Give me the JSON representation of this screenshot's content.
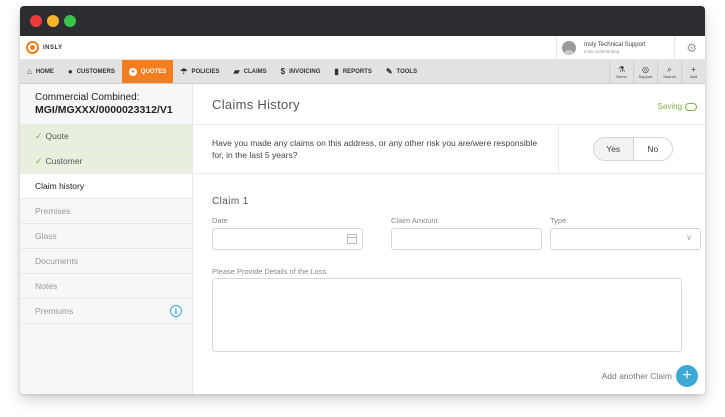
{
  "colors": {
    "titlebar": "#2b2d30",
    "close": "#ed3b3b",
    "minimize": "#f7b32b",
    "maximize": "#3bc24a",
    "accent": "#f47d20",
    "success": "#7cb342",
    "info": "#3ea7d4"
  },
  "brand": {
    "name": "INSLY",
    "icon": "insly-logo-icon"
  },
  "user": {
    "name": "Insly Technical Support",
    "role": "Insly underwriting",
    "icon": "user-avatar-icon"
  },
  "nav": {
    "items": [
      {
        "label": "HOME",
        "icon": "home-icon"
      },
      {
        "label": "CUSTOMERS",
        "icon": "person-icon"
      },
      {
        "label": "QUOTES",
        "icon": "quotes-icon"
      },
      {
        "label": "POLICIES",
        "icon": "umbrella-icon"
      },
      {
        "label": "CLAIMS",
        "icon": "car-icon"
      },
      {
        "label": "INVOICING",
        "icon": "dollar-icon"
      },
      {
        "label": "REPORTS",
        "icon": "bar-chart-icon"
      },
      {
        "label": "TOOLS",
        "icon": "wrench-icon"
      }
    ],
    "tools": [
      {
        "label": "Demo",
        "icon": "flask-icon"
      },
      {
        "label": "Support",
        "icon": "lifebuoy-icon"
      },
      {
        "label": "Search",
        "icon": "search-icon"
      },
      {
        "label": "Add",
        "icon": "plus-icon"
      }
    ]
  },
  "sidebar": {
    "policy_line1": "Commercial Combined:",
    "policy_line2": "MGI/MGXXX/0000023312/V1",
    "items": [
      {
        "label": "Quote"
      },
      {
        "label": "Customer"
      },
      {
        "label": "Claim history"
      },
      {
        "label": "Premises"
      },
      {
        "label": "Glass"
      },
      {
        "label": "Documents"
      },
      {
        "label": "Notes"
      },
      {
        "label": "Premiums",
        "badge": "i"
      }
    ]
  },
  "main": {
    "title": "Claims History",
    "saving": "Saving",
    "question": "Have you made any claims on this address, or any other risk you are/were responsible for, in the last 5 years?",
    "yes": "Yes",
    "no": "No",
    "claim_title": "Claim 1",
    "date_label": "Date",
    "amount_label": "Claim Amount",
    "type_label": "Type",
    "details_label": "Please Provide Details of the Loss",
    "add_claim": "Add another Claim"
  }
}
